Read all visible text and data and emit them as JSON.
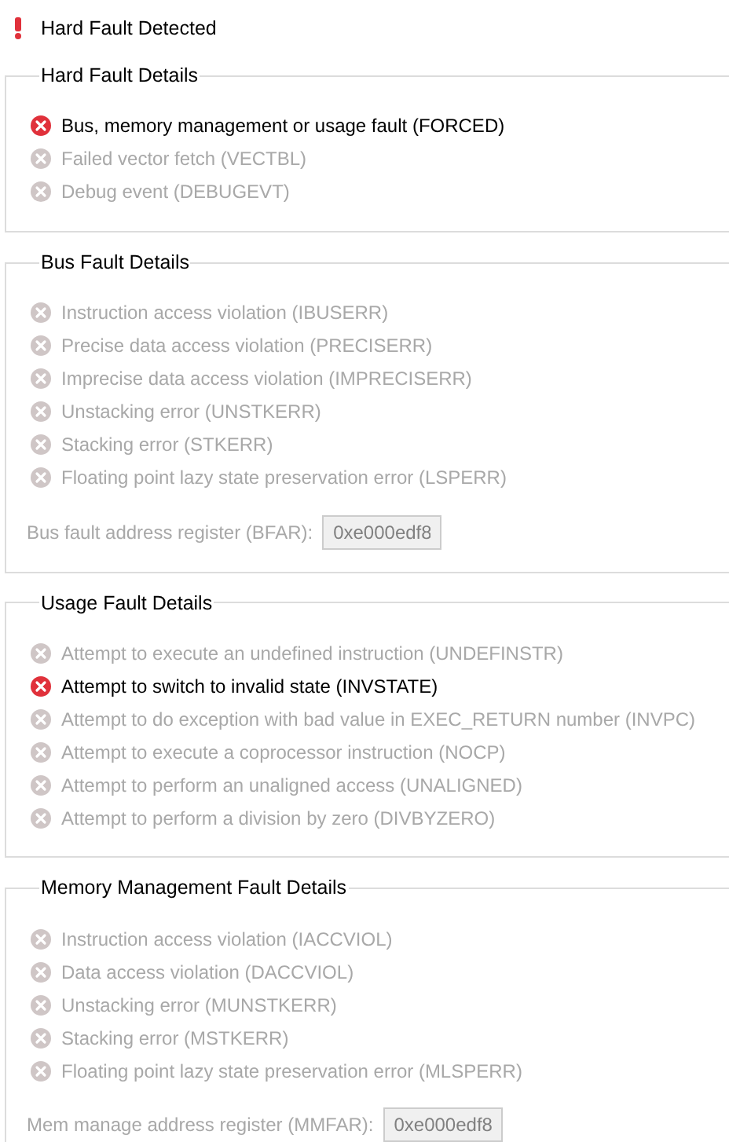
{
  "header": {
    "title": "Hard Fault Detected"
  },
  "groups": [
    {
      "title": "Hard Fault Details",
      "items": [
        {
          "label": "Bus, memory management or usage fault (FORCED)",
          "active": true
        },
        {
          "label": "Failed vector fetch (VECTBL)",
          "active": false
        },
        {
          "label": "Debug event (DEBUGEVT)",
          "active": false
        }
      ]
    },
    {
      "title": "Bus Fault Details",
      "items": [
        {
          "label": "Instruction access violation (IBUSERR)",
          "active": false
        },
        {
          "label": "Precise data access violation (PRECISERR)",
          "active": false
        },
        {
          "label": "Imprecise data access violation (IMPRECISERR)",
          "active": false
        },
        {
          "label": "Unstacking error (UNSTKERR)",
          "active": false
        },
        {
          "label": "Stacking error (STKERR)",
          "active": false
        },
        {
          "label": "Floating point lazy state preservation error (LSPERR)",
          "active": false
        }
      ],
      "address": {
        "label": "Bus fault address register (BFAR):",
        "value": "0xe000edf8"
      }
    },
    {
      "title": "Usage Fault Details",
      "items": [
        {
          "label": "Attempt to execute an undefined instruction (UNDEFINSTR)",
          "active": false
        },
        {
          "label": "Attempt to switch to invalid state (INVSTATE)",
          "active": true
        },
        {
          "label": "Attempt to do exception with bad value in EXEC_RETURN number (INVPC)",
          "active": false
        },
        {
          "label": "Attempt to execute a coprocessor instruction (NOCP)",
          "active": false
        },
        {
          "label": "Attempt to perform an unaligned access (UNALIGNED)",
          "active": false
        },
        {
          "label": "Attempt to perform a division by zero (DIVBYZERO)",
          "active": false
        }
      ]
    },
    {
      "title": "Memory Management Fault Details",
      "items": [
        {
          "label": "Instruction access violation (IACCVIOL)",
          "active": false
        },
        {
          "label": "Data access violation (DACCVIOL)",
          "active": false
        },
        {
          "label": "Unstacking error (MUNSTKERR)",
          "active": false
        },
        {
          "label": "Stacking error (MSTKERR)",
          "active": false
        },
        {
          "label": "Floating point lazy state preservation error (MLSPERR)",
          "active": false
        }
      ],
      "address": {
        "label": "Mem manage address register (MMFAR):",
        "value": "0xe000edf8"
      }
    }
  ]
}
